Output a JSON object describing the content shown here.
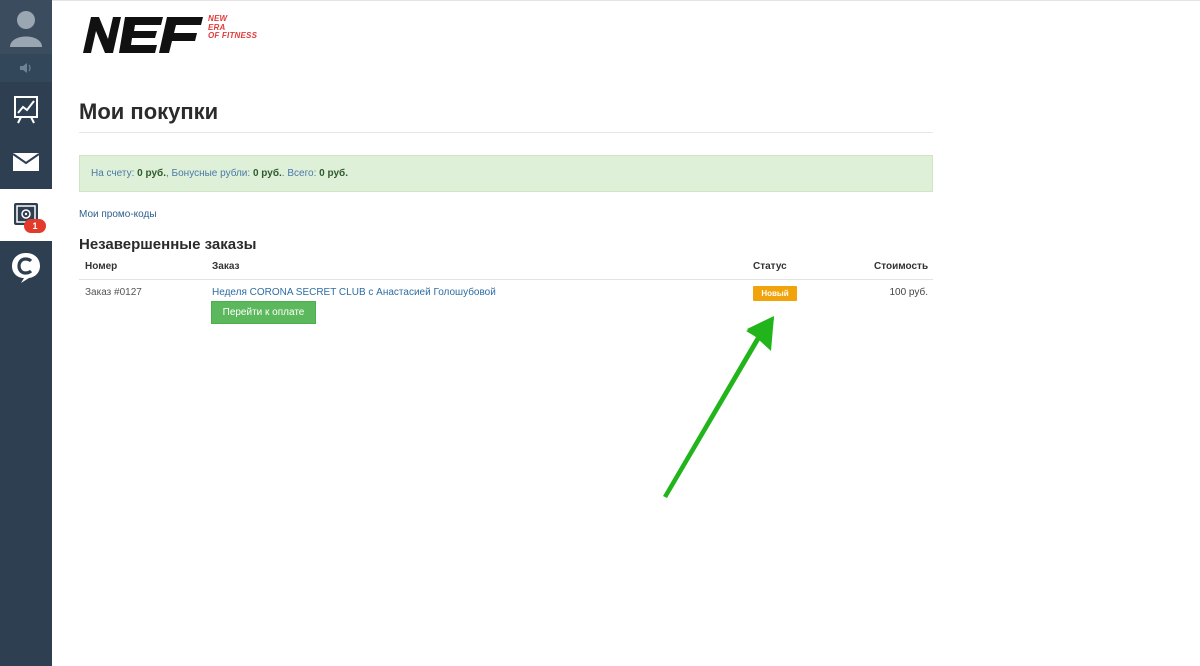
{
  "sidebar": {
    "items": [
      {
        "name": "avatar",
        "icon": "user-icon"
      },
      {
        "name": "sound",
        "icon": "speaker-icon"
      },
      {
        "name": "stats",
        "icon": "chart-icon"
      },
      {
        "name": "mail",
        "icon": "envelope-icon"
      },
      {
        "name": "safe",
        "icon": "safe-icon",
        "active": true,
        "badge": "1"
      },
      {
        "name": "brand",
        "icon": "c-logo-icon"
      }
    ]
  },
  "logo": {
    "text": "NEF",
    "tagline": [
      "NEW",
      "ERA",
      "OF FITNESS"
    ]
  },
  "page": {
    "title": "Мои покупки"
  },
  "balance": {
    "account_label": "На счету:",
    "account_value": "0 руб.",
    "bonus_label": "Бонусные рубли:",
    "bonus_value": "0 руб.",
    "total_label": "Всего:",
    "total_value": "0 руб.",
    "sep1": ", ",
    "sep2": ". "
  },
  "promo_link": "Мои промо-коды",
  "orders": {
    "title": "Незавершенные заказы",
    "columns": [
      "Номер",
      "Заказ",
      "Статус",
      "Стоимость"
    ],
    "rows": [
      {
        "number": "Заказ #0127",
        "name": "Неделя CORONA SECRET CLUB с Анастасией Голошубовой",
        "pay_button": "Перейти к оплате",
        "status": "Новый",
        "cost": "100 руб."
      }
    ]
  },
  "colors": {
    "sidebar": "#2e3f51",
    "status_new": "#f0a30a",
    "pay_button": "#5cb85c",
    "balance_bg": "#dff0d8",
    "annotation_arrow": "#22b51b",
    "logo_tag": "#e23a3a"
  }
}
